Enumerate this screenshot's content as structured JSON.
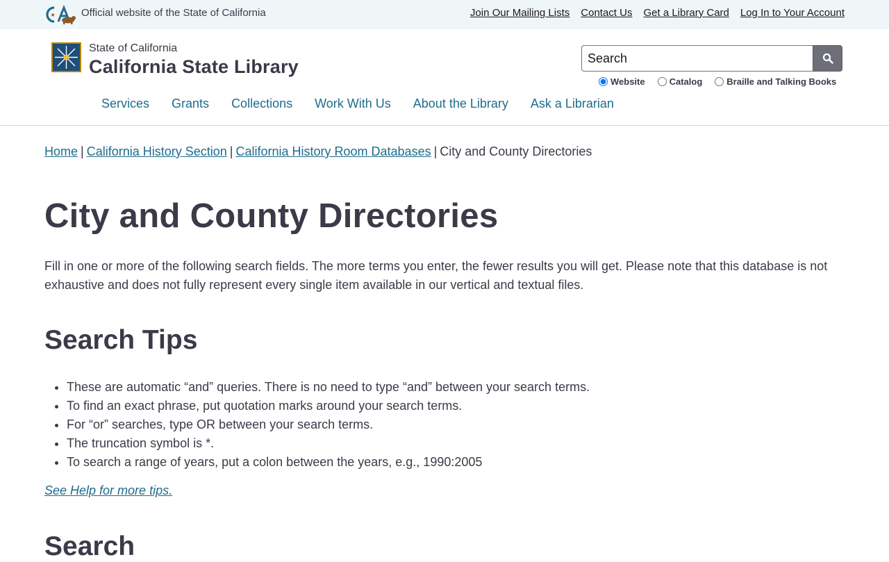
{
  "utility": {
    "official_text": "Official website of the State of California",
    "links": [
      "Join Our Mailing Lists",
      "Contact Us",
      "Get a Library Card",
      "Log In to Your Account"
    ]
  },
  "header": {
    "org_small": "State of California",
    "org_big": "California State Library",
    "search_placeholder": "Search",
    "search_scopes": [
      {
        "label": "Website",
        "checked": true
      },
      {
        "label": "Catalog",
        "checked": false
      },
      {
        "label": "Braille and Talking Books",
        "checked": false
      }
    ],
    "nav": [
      "Services",
      "Grants",
      "Collections",
      "Work With Us",
      "About the Library",
      "Ask a Librarian"
    ]
  },
  "breadcrumb": {
    "links": [
      "Home",
      "California History Section",
      "California History Room Databases"
    ],
    "current": "City and County Directories"
  },
  "main": {
    "title": "City and County Directories",
    "intro": "Fill in one or more of the following search fields. The more terms you enter, the fewer results you will get. Please note that this database is not exhaustive and does not fully represent every single item available in our vertical and textual files.",
    "tips_heading": "Search Tips",
    "tips": [
      "These are automatic “and” queries. There is no need to type “and” between your search terms.",
      "To find an exact phrase, put quotation marks around your search terms.",
      "For “or” searches, type OR between your search terms.",
      "The truncation symbol is *.",
      "To search a range of years, put a colon between the years, e.g., 1990:2005"
    ],
    "help_link": "See Help for more tips.",
    "search_heading": "Search"
  },
  "colors": {
    "utility_bg": "#eff6f8",
    "link": "#1f6c8c",
    "text": "#3b3a48",
    "search_button": "#6d6e78"
  },
  "icons": [
    "ca-state-logo",
    "library-star-logo",
    "search-icon"
  ]
}
